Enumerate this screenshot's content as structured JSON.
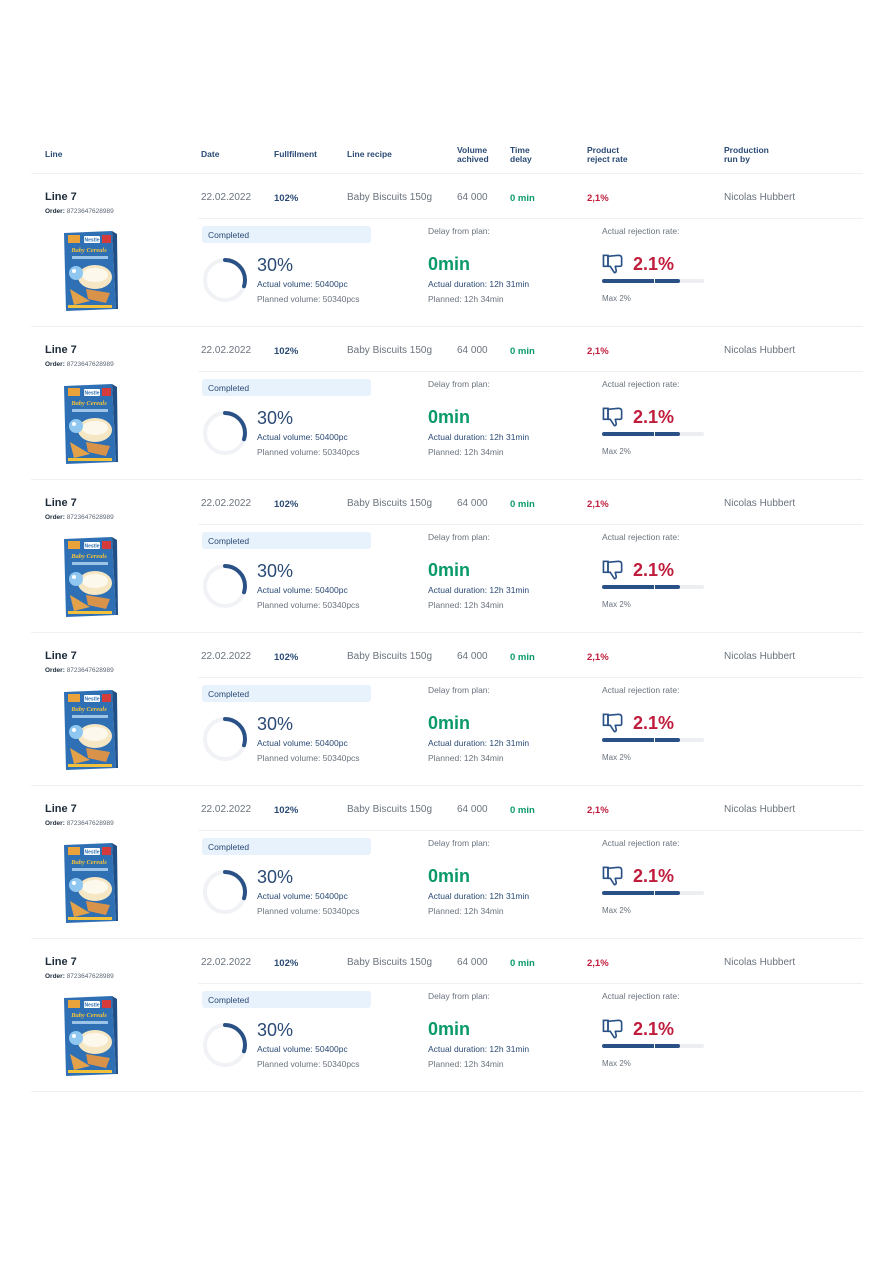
{
  "header": {
    "line": "Line",
    "date": "Date",
    "fulfilment": "Fullfilment",
    "recipe": "Line recipe",
    "volume_1": "Volume",
    "volume_2": "achived",
    "delay_1": "Time",
    "delay_2": "delay",
    "reject_1": "Product",
    "reject_2": "reject rate",
    "runby_1": "Production",
    "runby_2": "run by"
  },
  "colors": {
    "primary": "#2a4a75",
    "success": "#0a9a6a",
    "danger": "#c01c3c",
    "badge_bg": "#e8f2fc"
  },
  "rows": [
    {
      "line": "Line 7",
      "order_label": "Order:",
      "order_number": "8723647628989",
      "product_brand": "Nestle",
      "product_name": "Baby Cereals",
      "date": "22.02.2022",
      "fulfilment": "102%",
      "recipe": "Baby Biscuits 150g",
      "volume": "64 000",
      "delay": "0 min",
      "reject": "2,1%",
      "run_by": "Nicolas Hubbert",
      "status": "Completed",
      "progress_pct": "30%",
      "progress_value": 0.3,
      "actual_volume": "Actual volume: 50400pc",
      "planned_volume": "Planned volume: 50340pcs",
      "delay_label": "Delay from plan:",
      "delay_value": "0min",
      "actual_duration": "Actual duration: 12h 31min",
      "planned_duration": "Planned: 12h 34min",
      "rejection_label": "Actual rejection rate:",
      "rejection_value": "2.1%",
      "rejection_fill": 0.76,
      "rejection_max": "Max 2%",
      "thumb_icon": "thumbs-down-icon"
    },
    {
      "line": "Line 7",
      "order_label": "Order:",
      "order_number": "8723647628989",
      "product_brand": "Nestle",
      "product_name": "Baby Cereals",
      "date": "22.02.2022",
      "fulfilment": "102%",
      "recipe": "Baby Biscuits 150g",
      "volume": "64 000",
      "delay": "0 min",
      "reject": "2,1%",
      "run_by": "Nicolas Hubbert",
      "status": "Completed",
      "progress_pct": "30%",
      "progress_value": 0.3,
      "actual_volume": "Actual volume: 50400pc",
      "planned_volume": "Planned volume: 50340pcs",
      "delay_label": "Delay from plan:",
      "delay_value": "0min",
      "actual_duration": "Actual duration: 12h 31min",
      "planned_duration": "Planned: 12h 34min",
      "rejection_label": "Actual rejection rate:",
      "rejection_value": "2.1%",
      "rejection_fill": 0.76,
      "rejection_max": "Max 2%",
      "thumb_icon": "thumbs-down-icon"
    },
    {
      "line": "Line 7",
      "order_label": "Order:",
      "order_number": "8723647628989",
      "product_brand": "Nestle",
      "product_name": "Baby Cereals",
      "date": "22.02.2022",
      "fulfilment": "102%",
      "recipe": "Baby Biscuits 150g",
      "volume": "64 000",
      "delay": "0 min",
      "reject": "2,1%",
      "run_by": "Nicolas Hubbert",
      "status": "Completed",
      "progress_pct": "30%",
      "progress_value": 0.3,
      "actual_volume": "Actual volume: 50400pc",
      "planned_volume": "Planned volume: 50340pcs",
      "delay_label": "Delay from plan:",
      "delay_value": "0min",
      "actual_duration": "Actual duration: 12h 31min",
      "planned_duration": "Planned: 12h 34min",
      "rejection_label": "Actual rejection rate:",
      "rejection_value": "2.1%",
      "rejection_fill": 0.76,
      "rejection_max": "Max 2%",
      "thumb_icon": "thumbs-down-icon"
    },
    {
      "line": "Line 7",
      "order_label": "Order:",
      "order_number": "8723647628989",
      "product_brand": "Nestle",
      "product_name": "Baby Cereals",
      "date": "22.02.2022",
      "fulfilment": "102%",
      "recipe": "Baby Biscuits 150g",
      "volume": "64 000",
      "delay": "0 min",
      "reject": "2,1%",
      "run_by": "Nicolas Hubbert",
      "status": "Completed",
      "progress_pct": "30%",
      "progress_value": 0.3,
      "actual_volume": "Actual volume: 50400pc",
      "planned_volume": "Planned volume: 50340pcs",
      "delay_label": "Delay from plan:",
      "delay_value": "0min",
      "actual_duration": "Actual duration: 12h 31min",
      "planned_duration": "Planned: 12h 34min",
      "rejection_label": "Actual rejection rate:",
      "rejection_value": "2.1%",
      "rejection_fill": 0.76,
      "rejection_max": "Max 2%",
      "thumb_icon": "thumbs-down-icon"
    },
    {
      "line": "Line 7",
      "order_label": "Order:",
      "order_number": "8723647628989",
      "product_brand": "Nestle",
      "product_name": "Baby Cereals",
      "date": "22.02.2022",
      "fulfilment": "102%",
      "recipe": "Baby Biscuits 150g",
      "volume": "64 000",
      "delay": "0 min",
      "reject": "2,1%",
      "run_by": "Nicolas Hubbert",
      "status": "Completed",
      "progress_pct": "30%",
      "progress_value": 0.3,
      "actual_volume": "Actual volume: 50400pc",
      "planned_volume": "Planned volume: 50340pcs",
      "delay_label": "Delay from plan:",
      "delay_value": "0min",
      "actual_duration": "Actual duration: 12h 31min",
      "planned_duration": "Planned: 12h 34min",
      "rejection_label": "Actual rejection rate:",
      "rejection_value": "2.1%",
      "rejection_fill": 0.76,
      "rejection_max": "Max 2%",
      "thumb_icon": "thumbs-down-icon"
    },
    {
      "line": "Line 7",
      "order_label": "Order:",
      "order_number": "8723647628989",
      "product_brand": "Nestle",
      "product_name": "Baby Cereals",
      "date": "22.02.2022",
      "fulfilment": "102%",
      "recipe": "Baby Biscuits 150g",
      "volume": "64 000",
      "delay": "0 min",
      "reject": "2,1%",
      "run_by": "Nicolas Hubbert",
      "status": "Completed",
      "progress_pct": "30%",
      "progress_value": 0.3,
      "actual_volume": "Actual volume: 50400pc",
      "planned_volume": "Planned volume: 50340pcs",
      "delay_label": "Delay from plan:",
      "delay_value": "0min",
      "actual_duration": "Actual duration: 12h 31min",
      "planned_duration": "Planned: 12h 34min",
      "rejection_label": "Actual rejection rate:",
      "rejection_value": "2.1%",
      "rejection_fill": 0.76,
      "rejection_max": "Max 2%",
      "thumb_icon": "thumbs-down-icon"
    }
  ]
}
